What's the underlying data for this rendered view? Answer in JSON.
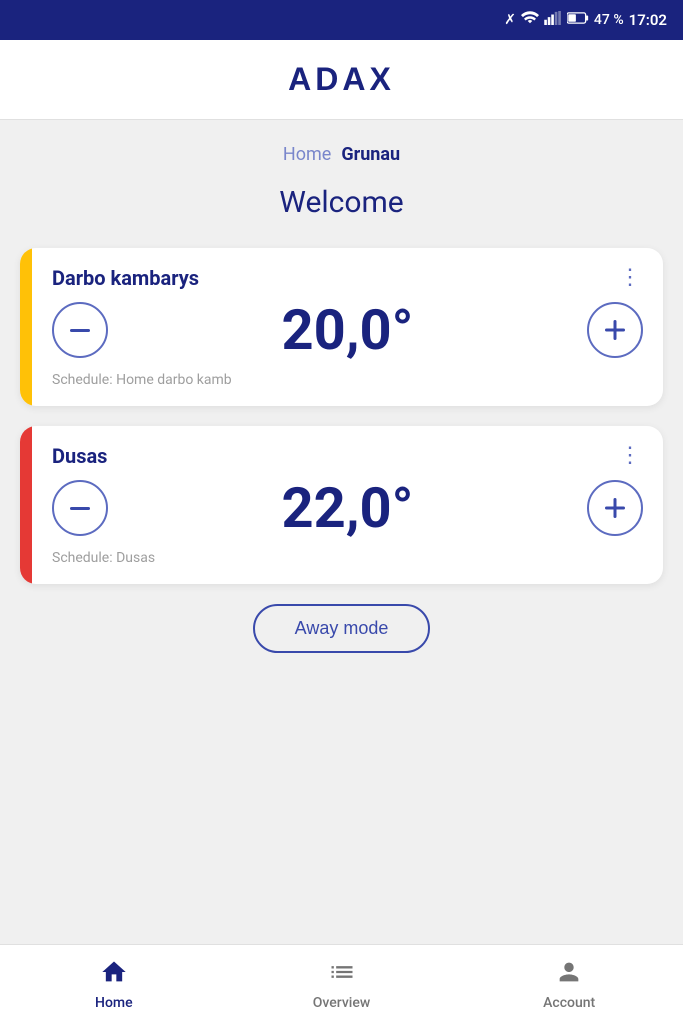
{
  "statusBar": {
    "battery": "47 %",
    "time": "17:02"
  },
  "header": {
    "logo": "ADAX"
  },
  "breadcrumb": {
    "home_label": "Home",
    "current_label": "Grunau"
  },
  "welcome": {
    "title": "Welcome"
  },
  "devices": [
    {
      "id": "darbo",
      "name": "Darbo kambarys",
      "temperature": "20,0°",
      "schedule": "Schedule: Home darbo kamb",
      "accent": "yellow"
    },
    {
      "id": "dusas",
      "name": "Dusas",
      "temperature": "22,0°",
      "schedule": "Schedule: Dusas",
      "accent": "red"
    }
  ],
  "awayMode": {
    "label": "Away mode"
  },
  "bottomNav": {
    "items": [
      {
        "id": "home",
        "label": "Home",
        "active": true
      },
      {
        "id": "overview",
        "label": "Overview",
        "active": false
      },
      {
        "id": "account",
        "label": "Account",
        "active": false
      }
    ]
  }
}
